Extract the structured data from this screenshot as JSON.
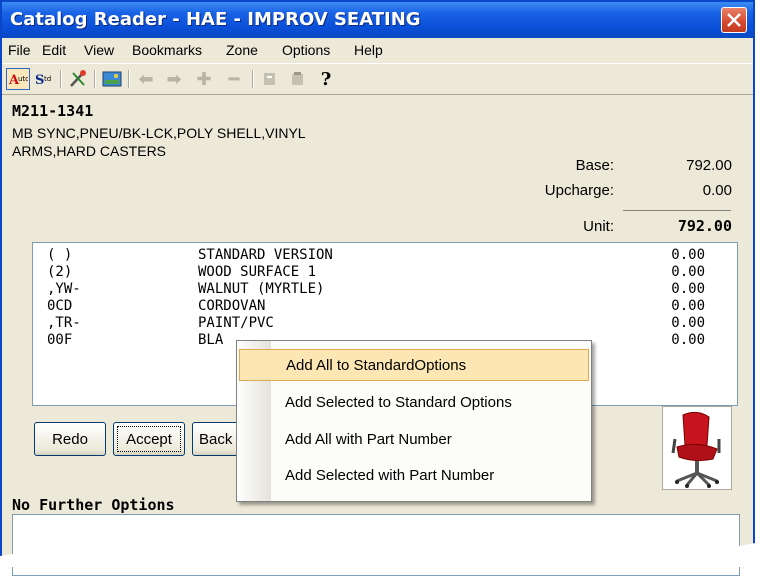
{
  "window": {
    "title": "Catalog Reader - HAE - IMPROV SEATING"
  },
  "menu": [
    "File",
    "Edit",
    "View",
    "Bookmarks",
    "Zone",
    "Options",
    "Help"
  ],
  "item": {
    "part_number": "M211-1341",
    "description_line1": "MB SYNC,PNEU/BK-LCK,POLY SHELL,VINYL",
    "description_line2": "ARMS,HARD CASTERS"
  },
  "pricing": {
    "base_label": "Base:",
    "base_value": "792.00",
    "upcharge_label": "Upcharge:",
    "upcharge_value": "0.00",
    "unit_label": "Unit:",
    "unit_value": "792.00"
  },
  "options": [
    {
      "code": "( )",
      "desc": "STANDARD VERSION",
      "price": "0.00"
    },
    {
      "code": "(2)",
      "desc": "WOOD SURFACE 1",
      "price": "0.00"
    },
    {
      "code": ",YW-",
      "desc": "WALNUT (MYRTLE)",
      "price": "0.00"
    },
    {
      "code": "0CD",
      "desc": "CORDOVAN",
      "price": "0.00"
    },
    {
      "code": ",TR-",
      "desc": "PAINT/PVC",
      "price": "0.00"
    },
    {
      "code": "00F",
      "desc": "BLA",
      "price": "0.00"
    }
  ],
  "buttons": {
    "redo": "Redo",
    "accept": "Accept",
    "back": "Back"
  },
  "status": "No Further Options",
  "context_menu": [
    "Add All to StandardOptions",
    "Add Selected to Standard Options",
    "Add All with Part Number",
    "Add Selected with Part Number"
  ],
  "toolbar": {
    "auto": "Auto",
    "std": "Std"
  },
  "colors": {
    "titlebar": "#0a4fd8",
    "highlight": "#fce6b4",
    "chair": "#c8141e"
  }
}
